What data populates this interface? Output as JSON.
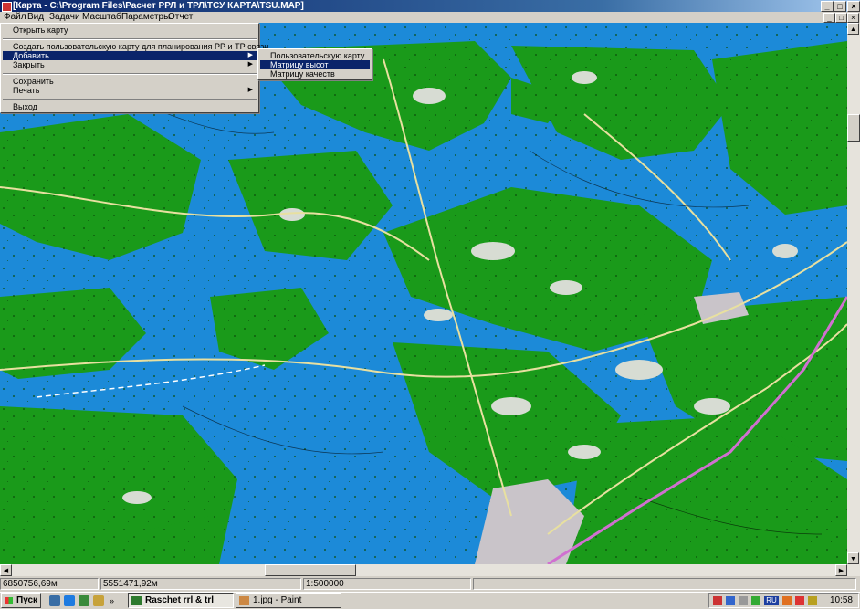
{
  "window": {
    "title": "[Карта - C:\\Program Files\\Расчет РРЛ и ТРЛ\\ТСУ КАРТА\\TSU.MAP]",
    "minimize": "_",
    "maximize": "□",
    "close": "×"
  },
  "menubar": {
    "items": [
      "Файл",
      "Вид",
      "Задачи",
      "Масштаб",
      "Параметры",
      "Отчет"
    ],
    "mdi_min": "_",
    "mdi_max": "□",
    "mdi_close": "×"
  },
  "file_menu": {
    "open": "Открыть карту",
    "create": "Создать пользовательскую карту для планирования РР и ТР связи",
    "add": "Добавить",
    "close": "Закрыть",
    "save": "Сохранить",
    "print": "Печать",
    "exit": "Выход"
  },
  "add_submenu": {
    "user_map": "Пользовательскую карту",
    "height_matrix": "Матрицу высот",
    "quality_matrix": "Матрицу качеств"
  },
  "status": {
    "x": "6850756,69м",
    "y": "5551471,92м",
    "scale": "1:500000"
  },
  "taskbar": {
    "start": "Пуск",
    "tasks": [
      "Raschet rrl & trl",
      "1.jpg - Paint"
    ],
    "clock": "10:58",
    "lang": "RU"
  },
  "colors": {
    "water": "#1c8ad8",
    "forest": "#1a9a1a",
    "open_land": "#d7dcd3",
    "road": "#e8e0a0",
    "railway": "#d070d0"
  }
}
